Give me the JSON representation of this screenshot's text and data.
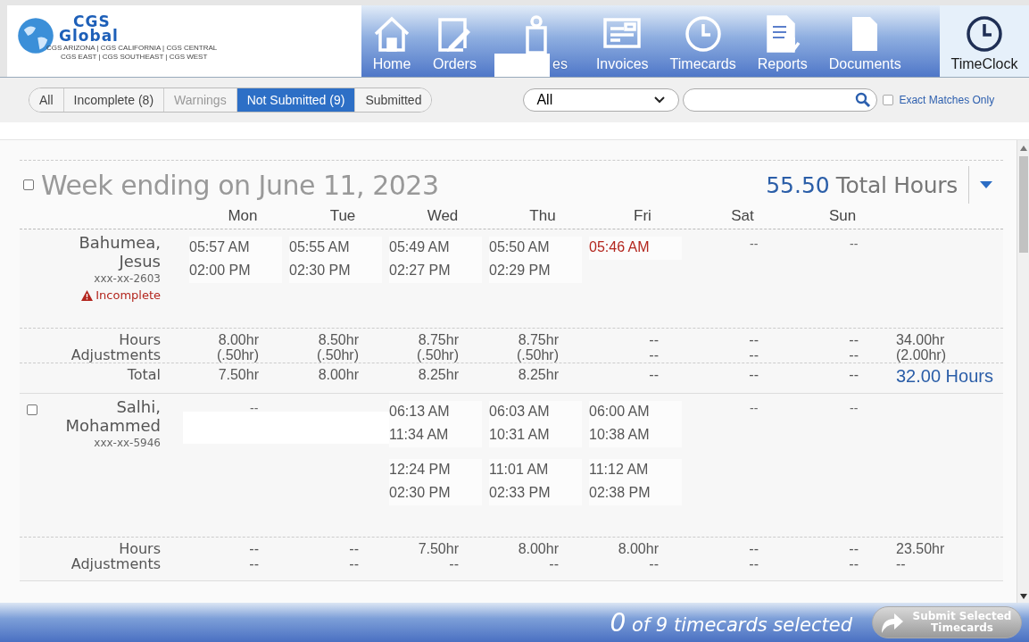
{
  "logo": {
    "line1": "CGS",
    "line2": "Global",
    "tagline1": "CGS ARIZONA | CGS CALIFORNIA  | CGS CENTRAL",
    "tagline2": "CGS EAST | CGS SOUTHEAST | CGS WEST"
  },
  "nav": [
    {
      "label": "Home",
      "kind": "home",
      "selected": false
    },
    {
      "label": "Orders",
      "kind": "orders",
      "selected": false
    },
    {
      "label": "es",
      "kind": "employees",
      "selected": false,
      "redacted": true
    },
    {
      "label": "Invoices",
      "kind": "invoices",
      "selected": false
    },
    {
      "label": "Timecards",
      "kind": "timecards",
      "selected": false
    },
    {
      "label": "Reports",
      "kind": "reports",
      "selected": false
    },
    {
      "label": "Documents",
      "kind": "documents",
      "selected": false
    },
    {
      "label": "TimeClock",
      "kind": "timeclock",
      "selected": true
    }
  ],
  "filters": [
    {
      "label": "All",
      "selected": false,
      "disabled": false
    },
    {
      "label": "Incomplete (8)",
      "selected": false,
      "disabled": false
    },
    {
      "label": "Warnings",
      "selected": false,
      "disabled": true
    },
    {
      "label": "Not Submitted (9)",
      "selected": true,
      "disabled": false
    },
    {
      "label": "Submitted",
      "selected": false,
      "disabled": false
    }
  ],
  "dropdown": {
    "value": "All"
  },
  "exact_matches": {
    "label": "Exact Matches Only",
    "checked": false
  },
  "week": {
    "title": "Week ending on June 11, 2023",
    "checked": false,
    "total": "55.50",
    "total_label": "Total Hours"
  },
  "days": [
    "Mon",
    "Tue",
    "Wed",
    "Thu",
    "Fri",
    "Sat",
    "Sun"
  ],
  "employees": [
    {
      "name": "Bahumea, Jesus",
      "ssn": "xxx-xx-2603",
      "status": {
        "kind": "incomplete",
        "label": "Incomplete"
      },
      "days": [
        {
          "shifts": [
            [
              "05:57 AM",
              "02:00 PM"
            ]
          ],
          "flagged": false
        },
        {
          "shifts": [
            [
              "05:55 AM",
              "02:30 PM"
            ]
          ],
          "flagged": false
        },
        {
          "shifts": [
            [
              "05:49 AM",
              "02:27 PM"
            ]
          ],
          "flagged": false
        },
        {
          "shifts": [
            [
              "05:50 AM",
              "02:29 PM"
            ]
          ],
          "flagged": false
        },
        {
          "shifts": [
            [
              "05:46 AM"
            ]
          ],
          "flagged": true
        },
        {
          "empty": "--"
        },
        {
          "empty": "--"
        }
      ],
      "summary": [
        {
          "label": "Hours",
          "values": [
            "8.00hr",
            "8.50hr",
            "8.75hr",
            "8.75hr",
            "--",
            "--",
            "--",
            "34.00hr"
          ]
        },
        {
          "label": "Adjustments",
          "values": [
            "(.50hr)",
            "(.50hr)",
            "(.50hr)",
            "(.50hr)",
            "--",
            "--",
            "--",
            "(2.00hr)"
          ]
        },
        {
          "label": "Total",
          "values": [
            "7.50hr",
            "8.00hr",
            "8.25hr",
            "8.25hr",
            "--",
            "--",
            "--"
          ],
          "grand": "32.00",
          "grand_label": "Hours"
        }
      ]
    },
    {
      "name": "Salhi, Mohammed",
      "ssn": "xxx-xx-5946",
      "selected": false,
      "days": [
        {
          "empty": "--"
        },
        {
          "redacted": true
        },
        {
          "shifts": [
            [
              "06:13 AM",
              "11:34 AM"
            ],
            [
              "12:24 PM",
              "02:30 PM"
            ]
          ],
          "flagged": false
        },
        {
          "shifts": [
            [
              "06:03 AM",
              "10:31 AM"
            ],
            [
              "11:01 AM",
              "02:33 PM"
            ]
          ],
          "flagged": false
        },
        {
          "shifts": [
            [
              "06:00 AM",
              "10:38 AM"
            ],
            [
              "11:12 AM",
              "02:38 PM"
            ]
          ],
          "flagged": false
        },
        {
          "empty": "--"
        },
        {
          "empty": "--"
        }
      ],
      "summary": [
        {
          "label": "Hours",
          "values": [
            "--",
            "--",
            "7.50hr",
            "8.00hr",
            "8.00hr",
            "--",
            "--",
            "23.50hr"
          ]
        },
        {
          "label": "Adjustments",
          "values": [
            "--",
            "--",
            "--",
            "--",
            "--",
            "--",
            "--",
            "--"
          ]
        }
      ]
    }
  ],
  "footer": {
    "count": "0",
    "text": "of 9 timecards selected",
    "button": "Submit Selected Timecards"
  }
}
